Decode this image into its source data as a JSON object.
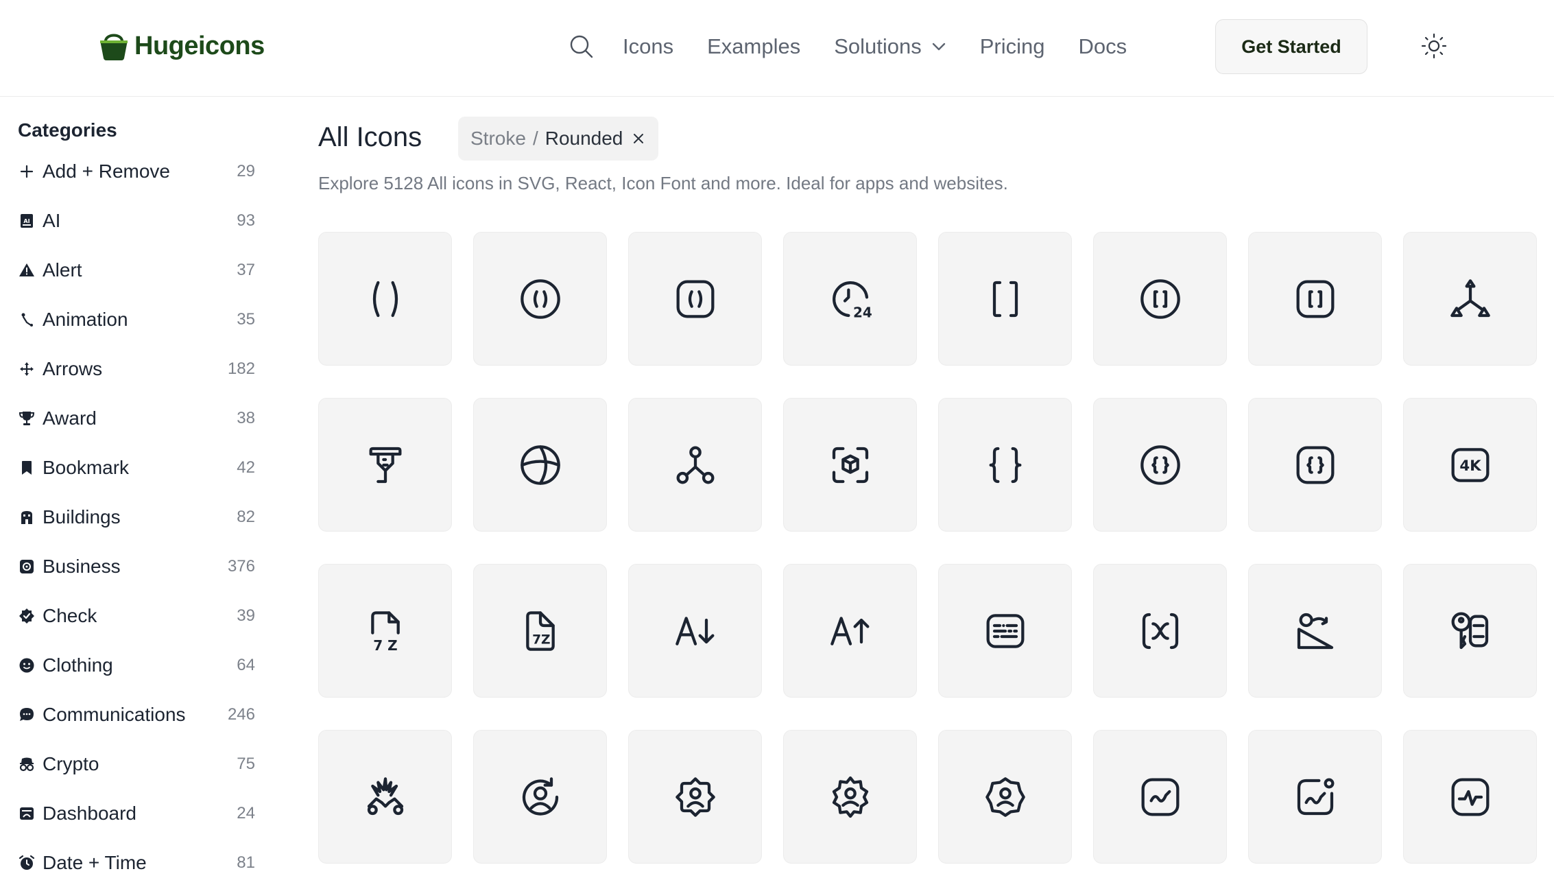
{
  "header": {
    "brand": "Hugeicons",
    "nav": {
      "icons": "Icons",
      "examples": "Examples",
      "solutions": "Solutions",
      "pricing": "Pricing",
      "docs": "Docs"
    },
    "cta_label": "Get Started"
  },
  "sidebar": {
    "title": "Categories",
    "items": [
      {
        "label": "Add + Remove",
        "count": "29",
        "icon": "plus-icon"
      },
      {
        "label": "AI",
        "count": "93",
        "icon": "ai-chip-icon"
      },
      {
        "label": "Alert",
        "count": "37",
        "icon": "alert-triangle-icon"
      },
      {
        "label": "Animation",
        "count": "35",
        "icon": "animation-icon"
      },
      {
        "label": "Arrows",
        "count": "182",
        "icon": "move-arrows-icon"
      },
      {
        "label": "Award",
        "count": "38",
        "icon": "trophy-icon"
      },
      {
        "label": "Bookmark",
        "count": "42",
        "icon": "bookmark-icon"
      },
      {
        "label": "Buildings",
        "count": "82",
        "icon": "building-icon"
      },
      {
        "label": "Business",
        "count": "376",
        "icon": "business-icon"
      },
      {
        "label": "Check",
        "count": "39",
        "icon": "check-badge-icon"
      },
      {
        "label": "Clothing",
        "count": "64",
        "icon": "clothing-icon"
      },
      {
        "label": "Communications",
        "count": "246",
        "icon": "chat-bubble-icon"
      },
      {
        "label": "Crypto",
        "count": "75",
        "icon": "crypto-icon"
      },
      {
        "label": "Dashboard",
        "count": "24",
        "icon": "dashboard-icon"
      },
      {
        "label": "Date + Time",
        "count": "81",
        "icon": "alarm-clock-icon"
      }
    ]
  },
  "main": {
    "title": "All Icons",
    "filter": {
      "style": "Stroke",
      "separator": "/",
      "variant": "Rounded"
    },
    "subtitle": "Explore 5128 All icons in SVG, React, Icon Font and more. Ideal for apps and websites.",
    "icons": [
      "parentheses-icon",
      "parentheses-circle-icon",
      "parentheses-square-icon",
      "clock-24-hours-icon",
      "square-brackets-icon",
      "square-brackets-circle-icon",
      "square-brackets-square-icon",
      "three-nodes-arrow-icon",
      "3d-printer-icon",
      "sphere-icon",
      "nodes-network-icon",
      "3d-scan-box-icon",
      "curly-braces-icon",
      "curly-braces-circle-icon",
      "curly-braces-square-icon",
      "4k-icon",
      "7z-file-icon",
      "7z-file-alt-icon",
      "text-size-down-icon",
      "text-size-up-icon",
      "abacus-icon",
      "variable-x-icon",
      "ramp-down-icon",
      "accessibility-key-icon",
      "accident-icon",
      "account-recovery-icon",
      "account-setting-sad-icon",
      "account-setting-icon",
      "account-setting-neutral-icon",
      "activity-chart-square-icon",
      "activity-chart-notification-icon",
      "activity-pulse-square-icon"
    ]
  }
}
